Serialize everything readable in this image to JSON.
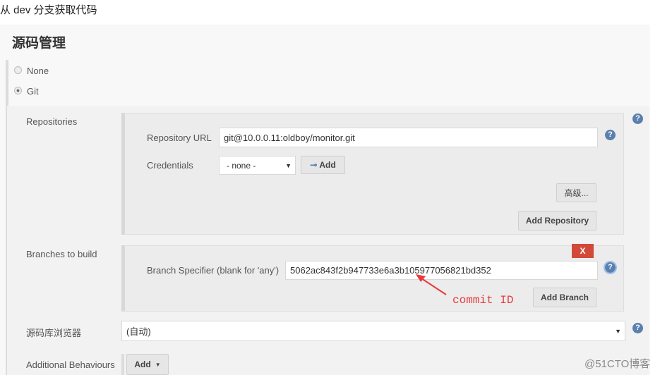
{
  "caption": "从 dev 分支获取代码",
  "section_title": "源码管理",
  "scm_options": [
    {
      "label": "None",
      "selected": false
    },
    {
      "label": "Git",
      "selected": true
    }
  ],
  "repositories": {
    "label": "Repositories",
    "url_label": "Repository URL",
    "url_value": "git@10.0.0.11:oldboy/monitor.git",
    "credentials_label": "Credentials",
    "credentials_value": "- none -",
    "add_label": "Add",
    "advanced_label": "高级...",
    "add_repository_label": "Add Repository"
  },
  "branches": {
    "label": "Branches to build",
    "delete_label": "X",
    "specifier_label": "Branch Specifier (blank for 'any')",
    "specifier_value": "5062ac843f2b947733e6a3b105977056821bd352",
    "add_branch_label": "Add Branch",
    "annotation": "commit ID"
  },
  "browser": {
    "label": "源码库浏览器",
    "value": "(自动)"
  },
  "behaviours": {
    "label": "Additional Behaviours",
    "add_label": "Add"
  },
  "help_glyph": "?",
  "watermark": "@51CTO博客",
  "colors": {
    "delete": "#d24939",
    "annotation": "#e83a3a",
    "help": "#5a7fb0"
  }
}
